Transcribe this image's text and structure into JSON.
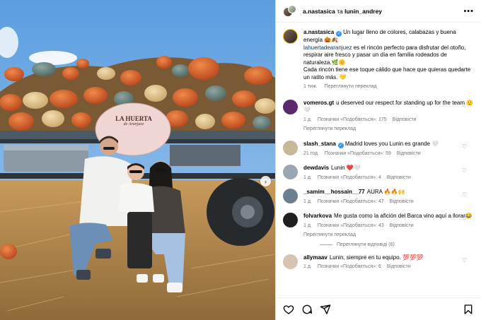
{
  "header": {
    "user1": "a.nastasica",
    "separator": "та",
    "user2": "lunin_andrey"
  },
  "sign": {
    "line1": "LA HUERTA",
    "line2": "de Aranjuez"
  },
  "caption": {
    "username": "a.nastasica",
    "text1": "Un lugar lleno de colores, calabazas y buena energía 🎃🍂",
    "mention": "lahuertadearanjuez",
    "text2": " es el rincón perfecto para disfrutar del otoño, respirar aire fresco y pasar un día en familia rodeados de naturaleza.🌿🌼",
    "text3": "Cada rincón tiene ese toque cálido que hace que quieras quedarte un ratito más. 💛",
    "time": "1 тиж.",
    "translate": "Переглянути переклад"
  },
  "comments": [
    {
      "user": "vomeros.gt",
      "text": "u deserved our respect for standing up for the team 🫡🤍",
      "time": "1 д.",
      "likes": "Позначки «Подобається»: 175",
      "reply": "Відповісти",
      "translate": "Переглянути переклад",
      "verified": false,
      "color": "#5a2a6e"
    },
    {
      "user": "slash_stana",
      "text": "Madrid loves you Lunin es grande 🤍",
      "time": "21 год.",
      "likes": "Позначки «Подобається»: 59",
      "reply": "Відповісти",
      "translate": "",
      "verified": true,
      "color": "#c8b89a"
    },
    {
      "user": "dewdavis",
      "text": "Lunin ❤️🤍",
      "time": "1 д.",
      "likes": "Позначки «Подобається»: 4",
      "reply": "Відповісти",
      "translate": "",
      "verified": false,
      "color": "#9aa6b2"
    },
    {
      "user": "_samim__hossain__77",
      "text": "AURA 🔥🔥🙌",
      "time": "1 д.",
      "likes": "Позначки «Подобається»: 47",
      "reply": "Відповісти",
      "translate": "",
      "verified": false,
      "color": "#6b7f8f"
    },
    {
      "user": "folvarkova",
      "text": "Me gusta como la afición del Barca vino aquí a llorar😂",
      "time": "1 д.",
      "likes": "Позначки «Подобається»: 43",
      "reply": "Відповісти",
      "translate": "Переглянути переклад",
      "verified": false,
      "color": "#1f1f1f"
    },
    {
      "user": "allymaav",
      "text": "Lunin, siempre en tu equipo. 💯💯💯",
      "time": "1 д.",
      "likes": "Позначки «Подобається»: 6",
      "reply": "Відповісти",
      "translate": "",
      "verified": false,
      "color": "#d8c2b0"
    }
  ],
  "view_replies": "Переглянути відповіді (6)",
  "icons": {
    "more": "more-horizontal-icon",
    "like": "heart-icon",
    "comment": "comment-icon",
    "share": "share-icon",
    "save": "bookmark-icon",
    "next": "chevron-right-icon"
  }
}
